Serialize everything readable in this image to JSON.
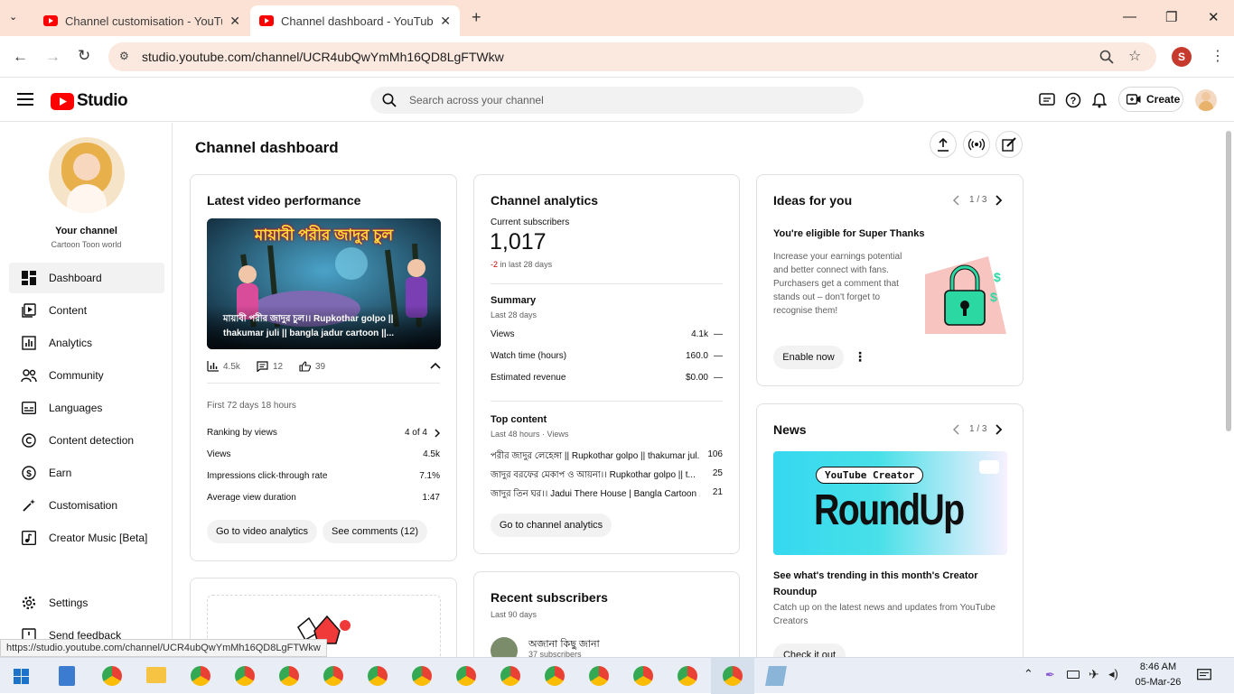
{
  "browser": {
    "tabs": [
      {
        "title": "Channel customisation - YouTu",
        "active": false
      },
      {
        "title": "Channel dashboard - YouTube S",
        "active": true
      }
    ],
    "url": "studio.youtube.com/channel/UCR4ubQwYmMh16QD8LgFTWkw",
    "profile_initial": "S",
    "status_url": "https://studio.youtube.com/channel/UCR4ubQwYmMh16QD8LgFTWkw"
  },
  "header": {
    "logo_text": "Studio",
    "search_placeholder": "Search across your channel",
    "create_label": "Create"
  },
  "sidebar": {
    "channel_label": "Your channel",
    "channel_name": "Cartoon Toon world",
    "items": [
      {
        "label": "Dashboard",
        "icon": "dashboard-icon",
        "selected": true
      },
      {
        "label": "Content",
        "icon": "content-icon"
      },
      {
        "label": "Analytics",
        "icon": "analytics-icon"
      },
      {
        "label": "Community",
        "icon": "community-icon"
      },
      {
        "label": "Languages",
        "icon": "languages-icon"
      },
      {
        "label": "Content detection",
        "icon": "copyright-icon"
      },
      {
        "label": "Earn",
        "icon": "dollar-icon"
      },
      {
        "label": "Customisation",
        "icon": "wand-icon"
      },
      {
        "label": "Creator Music [Beta]",
        "icon": "music-icon"
      }
    ],
    "settings_label": "Settings",
    "feedback_label": "Send feedback"
  },
  "page": {
    "title": "Channel dashboard"
  },
  "latest_video": {
    "card_title": "Latest video performance",
    "thumb_banner": "মায়াবী পরীর জাদুর চুল",
    "thumb_caption_1": "মায়াবী পরীর জাদুর চুল।। Rupkothar golpo ||",
    "thumb_caption_2": "thakumar juli || bangla jadur cartoon ||...",
    "views_short": "4.5k",
    "comments": "12",
    "likes": "39",
    "period": "First 72 days 18 hours",
    "ranking_label": "Ranking by views",
    "ranking_value": "4 of 4",
    "views_label": "Views",
    "views_value": "4.5k",
    "ctr_label": "Impressions click-through rate",
    "ctr_value": "7.1%",
    "avd_label": "Average view duration",
    "avd_value": "1:47",
    "btn_analytics": "Go to video analytics",
    "btn_comments": "See comments (12)"
  },
  "analytics": {
    "card_title": "Channel analytics",
    "subs_label": "Current subscribers",
    "subs_value": "1,017",
    "subs_change": "-2",
    "subs_change_suffix": "in last 28 days",
    "summary_title": "Summary",
    "summary_period": "Last 28 days",
    "rows": [
      {
        "label": "Views",
        "value": "4.1k",
        "trend": "—"
      },
      {
        "label": "Watch time (hours)",
        "value": "160.0",
        "trend": "—"
      },
      {
        "label": "Estimated revenue",
        "value": "$0.00",
        "trend": "—"
      }
    ],
    "top_title": "Top content",
    "top_period": "Last 48 hours · Views",
    "top_items": [
      {
        "title": "পরীর জাদুর লেহেঙ্গা || Rupkothar golpo || thakumar jul...",
        "views": "106"
      },
      {
        "title": "জাদুর বরফের মেকাপ ও আয়না।। Rupkothar golpo || t...",
        "views": "25"
      },
      {
        "title": "জাদুর তিন ঘর।। Jadui There House | Bangla Cartoon ...",
        "views": "21"
      }
    ],
    "btn_channel": "Go to channel analytics"
  },
  "recent_subs": {
    "card_title": "Recent subscribers",
    "period": "Last 90 days",
    "name": "অজানা কিছু জানা",
    "count": "37 subscribers"
  },
  "ideas": {
    "card_title": "Ideas for you",
    "pager": "1 / 3",
    "heading": "You're eligible for Super Thanks",
    "body": "Increase your earnings potential and better connect with fans. Purchasers get a comment that stands out – don't forget to recognise them!",
    "btn": "Enable now"
  },
  "news": {
    "card_title": "News",
    "pager": "1 / 3",
    "img_tag": "YouTube Creator",
    "img_title": "RoundUp",
    "heading": "See what's trending in this month's Creator Roundup",
    "body": "Catch up on the latest news and updates from YouTube Creators",
    "btn": "Check it out"
  },
  "taskbar": {
    "time": "8:46 AM",
    "date": "05-Mar-26"
  }
}
